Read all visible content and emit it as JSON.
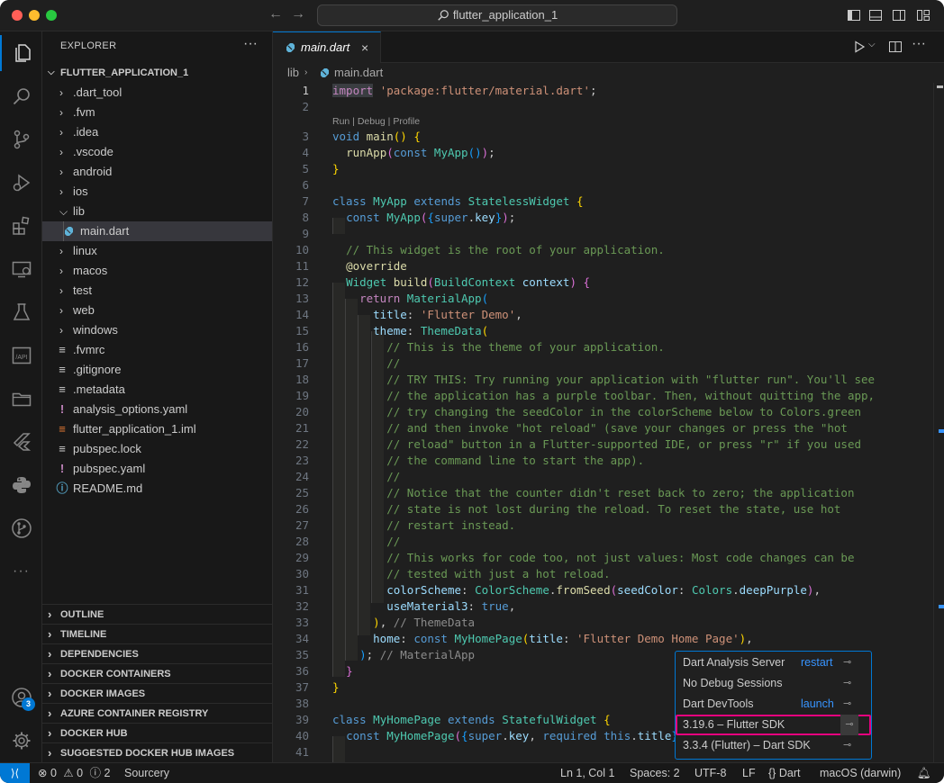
{
  "titlebar": {
    "search_label": "flutter_application_1"
  },
  "explorer": {
    "title": "EXPLORER",
    "more": "···",
    "project": "FLUTTER_APPLICATION_1",
    "items": [
      {
        "label": ".dart_tool",
        "kind": "folder"
      },
      {
        "label": ".fvm",
        "kind": "folder"
      },
      {
        "label": ".idea",
        "kind": "folder"
      },
      {
        "label": ".vscode",
        "kind": "folder"
      },
      {
        "label": "android",
        "kind": "folder"
      },
      {
        "label": "ios",
        "kind": "folder"
      },
      {
        "label": "lib",
        "kind": "folder-open"
      },
      {
        "label": "main.dart",
        "kind": "dart-file"
      },
      {
        "label": "linux",
        "kind": "folder"
      },
      {
        "label": "macos",
        "kind": "folder"
      },
      {
        "label": "test",
        "kind": "folder"
      },
      {
        "label": "web",
        "kind": "folder"
      },
      {
        "label": "windows",
        "kind": "folder"
      },
      {
        "label": ".fvmrc",
        "kind": "file"
      },
      {
        "label": ".gitignore",
        "kind": "file"
      },
      {
        "label": ".metadata",
        "kind": "file"
      },
      {
        "label": "analysis_options.yaml",
        "kind": "yaml-file"
      },
      {
        "label": "flutter_application_1.iml",
        "kind": "rss-file"
      },
      {
        "label": "pubspec.lock",
        "kind": "file"
      },
      {
        "label": "pubspec.yaml",
        "kind": "yaml-file"
      },
      {
        "label": "README.md",
        "kind": "info-file"
      }
    ],
    "sections": [
      "OUTLINE",
      "TIMELINE",
      "DEPENDENCIES",
      "DOCKER CONTAINERS",
      "DOCKER IMAGES",
      "AZURE CONTAINER REGISTRY",
      "DOCKER HUB",
      "SUGGESTED DOCKER HUB IMAGES"
    ]
  },
  "activity": {
    "accounts_badge": "3"
  },
  "editor": {
    "tab_label": "main.dart",
    "tab_close": "×",
    "breadcrumb_folder": "lib",
    "breadcrumb_file": "main.dart",
    "codelens": "Run | Debug | Profile"
  },
  "popup": {
    "rows": [
      {
        "label": "Dart Analysis Server",
        "action": "restart"
      },
      {
        "label": "No Debug Sessions",
        "action": ""
      },
      {
        "label": "Dart DevTools",
        "action": "launch"
      },
      {
        "label": "3.19.6 – Flutter SDK",
        "action": ""
      },
      {
        "label": "3.3.4 (Flutter) – Dart SDK",
        "action": ""
      }
    ]
  },
  "status": {
    "problems": "0",
    "warnings": "0",
    "info": "2",
    "sourcery": "Sourcery",
    "position": "Ln 1, Col 1",
    "spaces": "Spaces: 2",
    "encoding": "UTF-8",
    "eol": "LF",
    "language": "Dart",
    "platform": "macOS (darwin)"
  },
  "colors": {
    "accent": "#0078d4",
    "highlight_outline": "#e6007e"
  }
}
